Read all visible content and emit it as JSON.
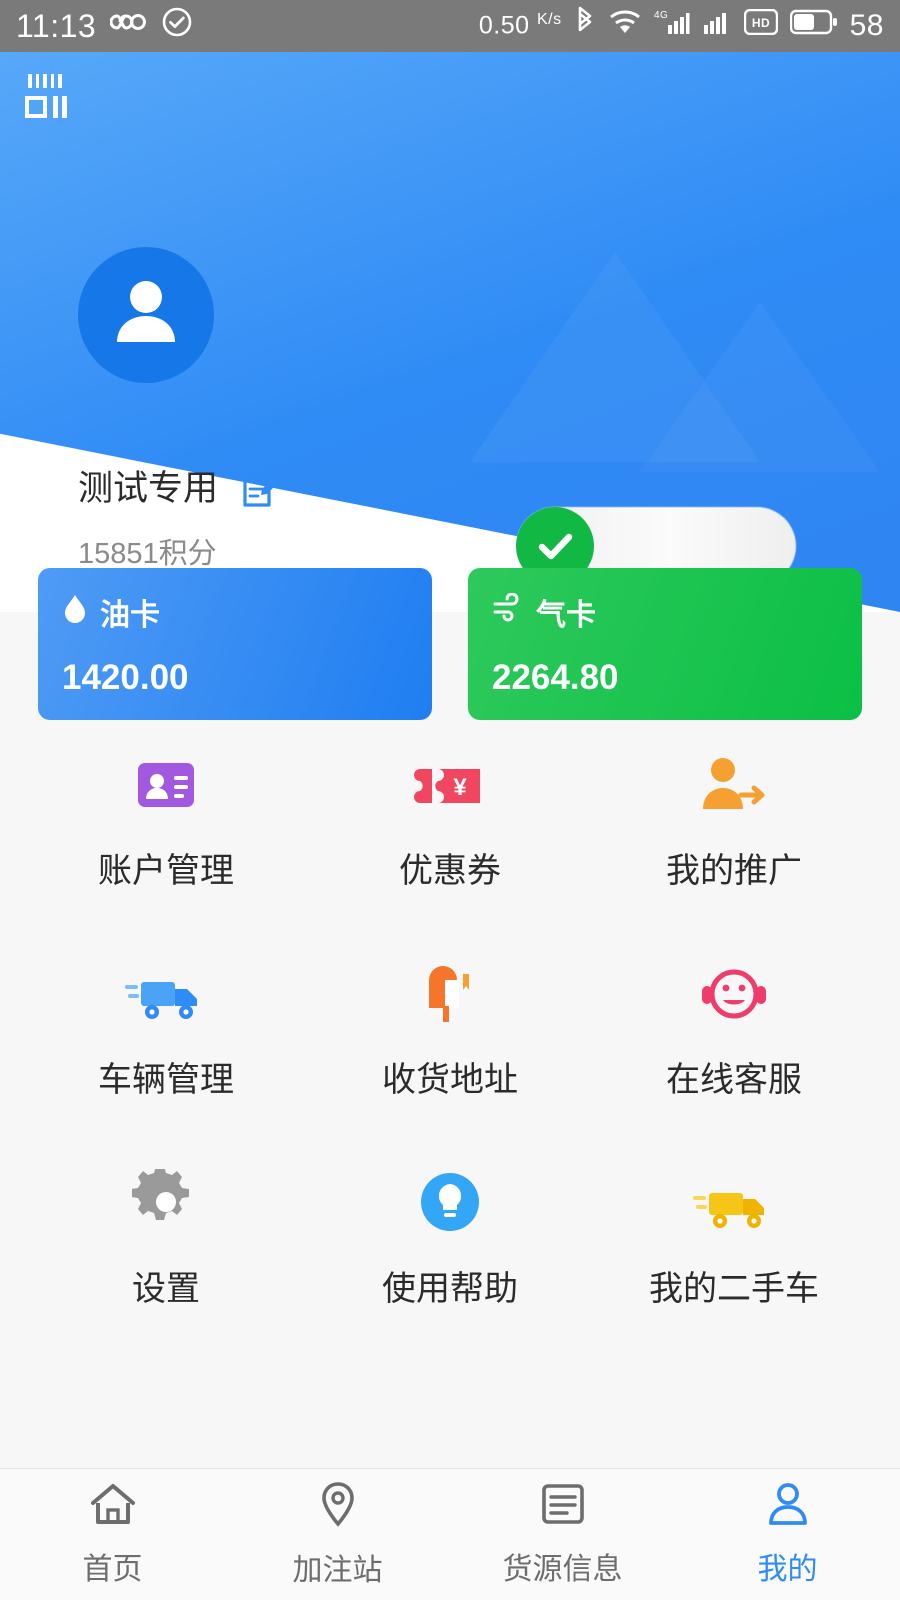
{
  "status_bar": {
    "time": "11:13",
    "infinity_icon": "infinity-icon",
    "check_icon": "check-circle-icon",
    "net_speed": "0.50",
    "net_speed_unit": "K/s",
    "bluetooth_icon": "bluetooth-icon",
    "wifi_icon": "wifi-icon",
    "signal_4g_label": "4G",
    "signal_icon_1": "signal-bars-icon",
    "signal_icon_2": "signal-bars-icon",
    "hd_label": "HD",
    "battery_icon": "battery-icon",
    "battery_level": "58"
  },
  "header": {
    "scan_icon": "scan-qr-icon",
    "avatar_icon": "user-avatar-icon",
    "user_name": "测试专用",
    "edit_icon": "edit-pencil-icon",
    "points": "15851积分",
    "verified_badge_icon": "verified-check-icon"
  },
  "balance_cards": [
    {
      "icon": "oil-drop-icon",
      "title": "油卡",
      "amount": "1420.00",
      "color": "#2f8bf5"
    },
    {
      "icon": "gas-wind-icon",
      "title": "气卡",
      "amount": "2264.80",
      "color": "#12bf48"
    }
  ],
  "menu_items": [
    {
      "icon": "account-card-icon",
      "label": "账户管理",
      "color": "#a259e0"
    },
    {
      "icon": "coupon-icon",
      "label": "优惠券",
      "color": "#f0465f"
    },
    {
      "icon": "promotion-user-icon",
      "label": "我的推广",
      "color": "#f5a033"
    },
    {
      "icon": "truck-icon",
      "label": "车辆管理",
      "color": "#4aa3f5"
    },
    {
      "icon": "mailbox-icon",
      "label": "收货地址",
      "color": "#f5762b"
    },
    {
      "icon": "customer-service-icon",
      "label": "在线客服",
      "color": "#ef3d6b"
    },
    {
      "icon": "gear-icon",
      "label": "设置",
      "color": "#9a9a9a"
    },
    {
      "icon": "lightbulb-icon",
      "label": "使用帮助",
      "color": "#33a6f5"
    },
    {
      "icon": "used-truck-icon",
      "label": "我的二手车",
      "color": "#f5c518"
    }
  ],
  "tab_bar": {
    "active_color": "#2f8bf5",
    "inactive_color": "#6d6d6d",
    "items": [
      {
        "icon": "home-icon",
        "label": "首页",
        "active": false
      },
      {
        "icon": "location-pin-icon",
        "label": "加注站",
        "active": false
      },
      {
        "icon": "document-icon",
        "label": "货源信息",
        "active": false
      },
      {
        "icon": "person-icon",
        "label": "我的",
        "active": true
      }
    ]
  }
}
